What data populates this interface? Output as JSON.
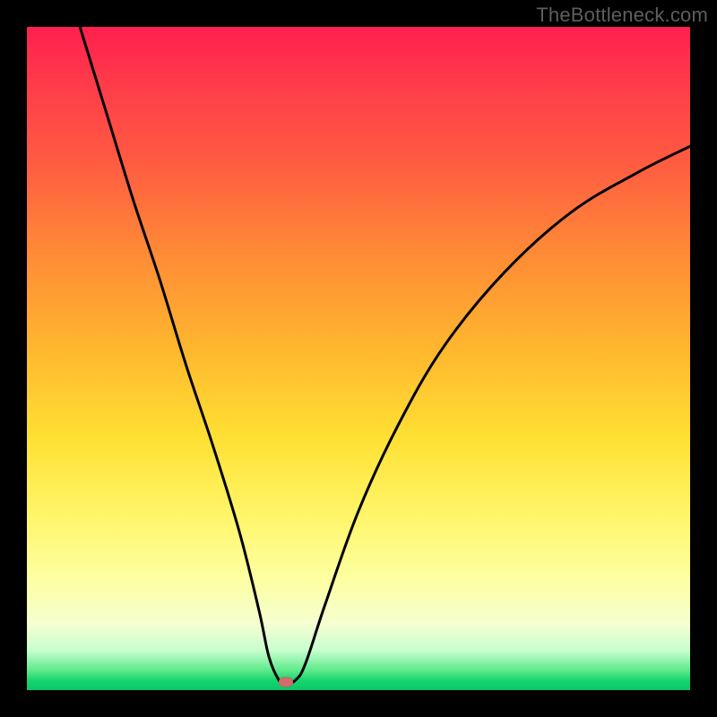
{
  "watermark": "TheBottleneck.com",
  "chart_data": {
    "type": "line",
    "title": "",
    "xlabel": "",
    "ylabel": "",
    "xlim": [
      0,
      100
    ],
    "ylim": [
      0,
      100
    ],
    "colors": {
      "curve": "#000000",
      "marker": "#d66a6a",
      "gradient_top": "#ff1f4f",
      "gradient_bottom": "#0bc565"
    },
    "marker": {
      "x": 39,
      "y": 1.2
    },
    "series": [
      {
        "name": "bottleneck-curve",
        "x": [
          8,
          12,
          16,
          20,
          24,
          28,
          32,
          35,
          36.5,
          38,
          39,
          40.5,
          42,
          45,
          50,
          56,
          63,
          72,
          82,
          92,
          100
        ],
        "y": [
          100,
          87,
          74,
          62,
          49,
          37,
          24,
          12,
          5,
          1.5,
          1,
          1.5,
          4,
          13,
          27,
          40,
          52,
          63,
          72,
          78,
          82
        ]
      }
    ]
  }
}
